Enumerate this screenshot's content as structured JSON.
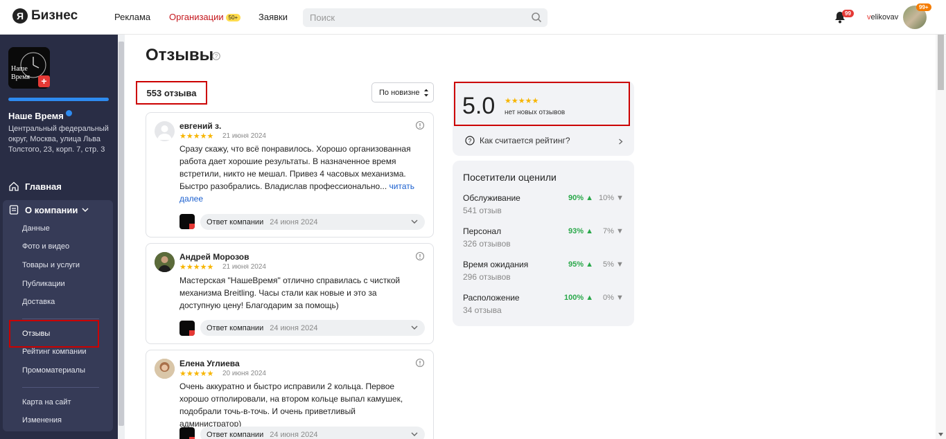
{
  "header": {
    "logo_letter": "Я",
    "logo_text": "Бизнес",
    "nav": [
      {
        "label": "Реклама"
      },
      {
        "label": "Организации",
        "badge": "50+"
      },
      {
        "label": "Заявки"
      }
    ],
    "search_placeholder": "Поиск",
    "notifications_badge": "99",
    "username_first": "v",
    "username_rest": "elikovav",
    "avatar_badge": "99+"
  },
  "sidebar": {
    "company_name": "Наше Время",
    "company_logo_text_1": "Наше",
    "company_logo_text_2": "Время",
    "company_address": "Центральный федеральный округ, Москва, улица Льва Толстого, 23, корп. 7, стр. 3",
    "profile_progress": 1.0,
    "main_item": "Главная",
    "group_label": "О компании",
    "sub_items": [
      "Данные",
      "Фото и видео",
      "Товары и услуги",
      "Публикации",
      "Доставка",
      "Отзывы",
      "Рейтинг компании",
      "Промоматериалы",
      "Карта на сайт",
      "Изменения"
    ]
  },
  "main": {
    "title": "Отзывы",
    "review_count": "553 отзыва",
    "sort_label": "По новизне",
    "reviews": [
      {
        "author": "евгений з.",
        "stars": "★★★★★",
        "date": "21 июня 2024",
        "text": "Сразу скажу, что всё понравилось. Хорошо организованная работа дает хорошие результаты. В назначенное время встретили, никто не мешал. Привез 4 часовых механизма. Быстро разобрались. Владислав профессионально...",
        "read_more": "читать далее",
        "reply_label": "Ответ компании",
        "reply_date": "24 июня 2024"
      },
      {
        "author": "Андрей Морозов",
        "stars": "★★★★★",
        "date": "21 июня 2024",
        "text": "Мастерская \"НашеВремя\" отлично справилась с чисткой механизма Breitling. Часы стали как новые и это за доступную цену! Благодарим за помощь)",
        "reply_label": "Ответ компании",
        "reply_date": "24 июня 2024"
      },
      {
        "author": "Елена Углиева",
        "stars": "★★★★★",
        "date": "20 июня 2024",
        "text": "Очень аккуратно и быстро исправили 2 кольца. Первое хорошо отполировали, на втором кольце выпал камушек, подобрали точь-в-точь. И очень приветливый администратор)",
        "reply_label": "Ответ компании",
        "reply_date": "24 июня 2024"
      }
    ]
  },
  "rating": {
    "value": "5.0",
    "stars": "★★★★★",
    "subtitle": "нет новых отзывов",
    "how_label": "Как считается рейтинг?"
  },
  "visitors": {
    "title": "Посетители оценили",
    "criteria": [
      {
        "name": "Обслуживание",
        "count": "541 отзыв",
        "positive": "90%",
        "negative": "10%"
      },
      {
        "name": "Персонал",
        "count": "326 отзывов",
        "positive": "93%",
        "negative": "7%"
      },
      {
        "name": "Время ожидания",
        "count": "296 отзывов",
        "positive": "95%",
        "negative": "5%"
      },
      {
        "name": "Расположение",
        "count": "34 отзыва",
        "positive": "100%",
        "negative": "0%"
      }
    ]
  },
  "colors": {
    "sidebar_bg": "#292d45",
    "accent_red": "#c4161c",
    "highlight_box": "#cc0000",
    "star": "#f7b500",
    "positive": "#2aa84a"
  }
}
